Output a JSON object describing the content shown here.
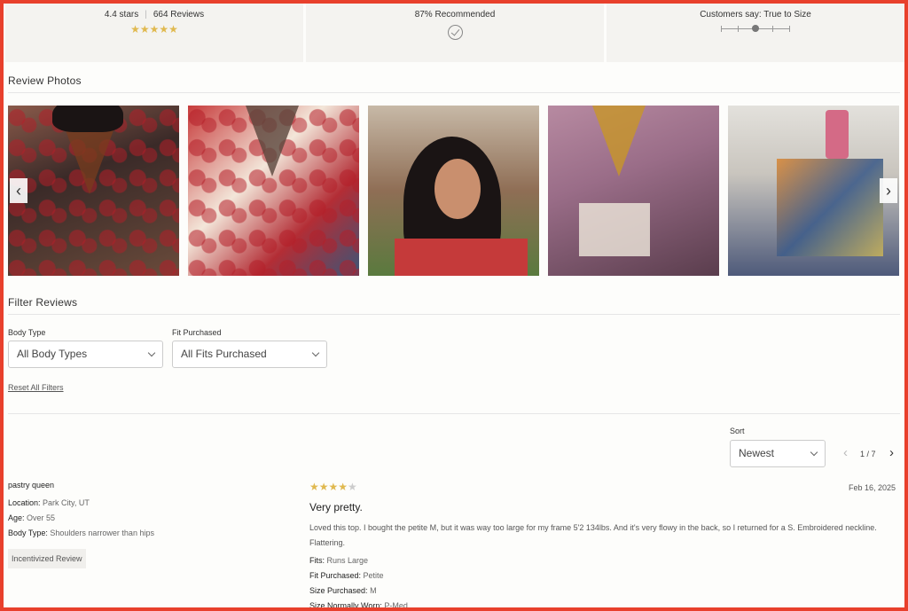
{
  "summary": {
    "rating_text": "4.4 stars",
    "reviews_text": "664 Reviews",
    "rating_value": 4.4,
    "stars_glyph": "★★★★★",
    "recommended_text": "87% Recommended",
    "fit_text": "Customers say: True to Size",
    "fit_position_fraction": 0.5
  },
  "photos": {
    "title": "Review Photos",
    "count": 5,
    "prev_label": "‹",
    "next_label": "›"
  },
  "filters": {
    "title": "Filter Reviews",
    "body_type_label": "Body Type",
    "body_type_value": "All Body Types",
    "fit_label": "Fit Purchased",
    "fit_value": "All Fits Purchased",
    "reset_label": "Reset All Filters"
  },
  "sort": {
    "label": "Sort",
    "value": "Newest"
  },
  "pagination": {
    "prev": "‹",
    "info": "1 / 7",
    "next": "›"
  },
  "review": {
    "reviewer": "pastry queen",
    "location_label": "Location:",
    "location": "Park City, UT",
    "age_label": "Age:",
    "age": "Over 55",
    "body_type_label": "Body Type:",
    "body_type": "Shoulders narrower than hips",
    "badge": "Incentivized Review",
    "rating": 4,
    "stars_on": "★★★★",
    "stars_off": "★",
    "date": "Feb 16, 2025",
    "title": "Very pretty.",
    "body": "Loved this top. I bought the petite M, but it was way too large for my frame 5'2 134lbs. And it's very flowy in the back, so I returned for a S. Embroidered neckline. Flattering.",
    "fits_label": "Fits:",
    "fits": "Runs Large",
    "fit_purchased_label": "Fit Purchased:",
    "fit_purchased": "Petite",
    "size_purchased_label": "Size Purchased:",
    "size_purchased": "M",
    "size_worn_label": "Size Normally Worn:",
    "size_worn": "P-Med"
  },
  "colors": {
    "frame_border": "#e8402c",
    "star_gold": "#e0b94f"
  }
}
